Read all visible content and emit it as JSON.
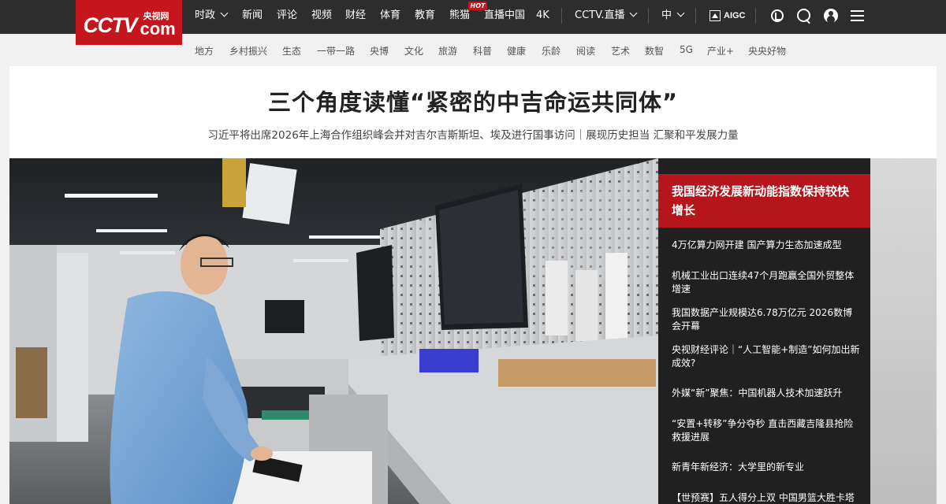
{
  "logo": {
    "main": "CCTV",
    "sub": "央视网",
    "com": "com"
  },
  "nav": {
    "items": [
      {
        "label": "时政",
        "dropdown": true
      },
      {
        "label": "新闻"
      },
      {
        "label": "评论"
      },
      {
        "label": "视频"
      },
      {
        "label": "财经"
      },
      {
        "label": "体育"
      },
      {
        "label": "教育"
      },
      {
        "label": "熊猫"
      },
      {
        "label": "直播中国"
      },
      {
        "label": "4K"
      },
      {
        "label": "CCTV.直播",
        "dropdown": true
      },
      {
        "label": "中",
        "dropdown": true
      }
    ],
    "hot_badge": "HOT",
    "aigc_label": "AIGC",
    "icons": [
      "accessibility-icon",
      "search-icon",
      "user-icon",
      "menu-icon"
    ]
  },
  "subnav": [
    "地方",
    "乡村振兴",
    "生态",
    "一带一路",
    "央博",
    "文化",
    "旅游",
    "科普",
    "健康",
    "乐龄",
    "阅读",
    "艺术",
    "数智",
    "5G",
    "产业+",
    "央央好物"
  ],
  "headline": {
    "title": "三个角度读懂“紧密的中吉命运共同体”",
    "subtitle": "习近平将出席2026年上海合作组织峰会并对吉尔吉斯斯坦、埃及进行国事访问｜展现历史担当 汇聚和平发展力量"
  },
  "news_panel": {
    "feature": "我国经济发展新动能指数保持较快增长",
    "items": [
      "4万亿算力网开建 国产算力生态加速成型",
      "机械工业出口连续47个月跑赢全国外贸整体增速",
      "我国数据产业规模达6.78万亿元 2026数博会开幕",
      "央视财经评论｜“人工智能+制造”如何加出新成效?",
      "外媒“新”聚焦：中国机器人技术加速跃升",
      "“安置+转移”争分夺秒 直击西藏吉隆县抢险救援进展",
      "新青年新经济：大学里的新专业",
      "【世预赛】五人得分上双 中国男篮大胜卡塔尔"
    ]
  },
  "colors": {
    "topbar": "#2d2d2d",
    "brand_red": "#c4161c",
    "feature_red": "#b5161b",
    "page_bg": "#f1f1f1"
  }
}
